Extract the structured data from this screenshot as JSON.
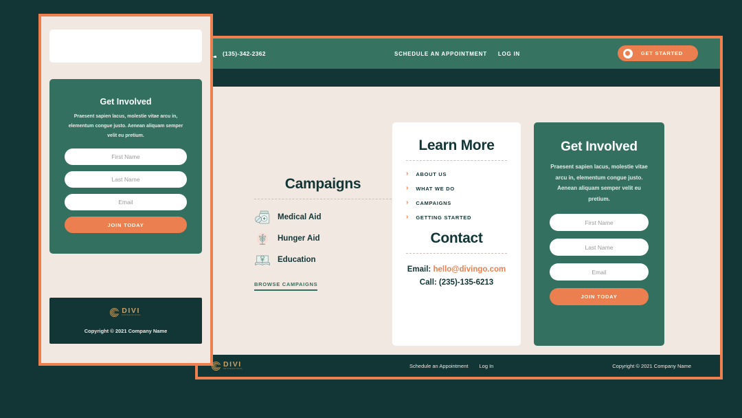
{
  "colors": {
    "page_bg": "#123536",
    "panel_border": "#ee7f4e",
    "cream": "#f1e8e2",
    "green": "#337060",
    "dark_teal": "#123536",
    "orange": "#ec7f50",
    "gold": "#c8a268"
  },
  "desktop": {
    "topbar": {
      "phone": "(135)-342-2362",
      "phone_icon": "phone-icon",
      "links": [
        {
          "label": "SCHEDULE AN APPOINTMENT"
        },
        {
          "label": "LOG IN"
        }
      ],
      "cta": {
        "label": "GET STARTED",
        "icon": "circle-dot-icon"
      }
    },
    "campaigns": {
      "title": "Campaigns",
      "items": [
        {
          "label": "Medical Aid",
          "icon": "medicine-bottle-icon"
        },
        {
          "label": "Hunger Aid",
          "icon": "plant-sprout-icon"
        },
        {
          "label": "Education",
          "icon": "open-book-icon"
        }
      ],
      "browse_label": "BROWSE CAMPAIGNS"
    },
    "learn_more": {
      "title": "Learn More",
      "items": [
        {
          "label": "ABOUT US",
          "icon": "chevron-right-icon"
        },
        {
          "label": "WHAT WE DO",
          "icon": "chevron-right-icon"
        },
        {
          "label": "CAMPAIGNS",
          "icon": "chevron-right-icon"
        },
        {
          "label": "GETTING STARTED",
          "icon": "chevron-right-icon"
        }
      ],
      "contact_title": "Contact",
      "email_label": "Email:",
      "email_value": "hello@divingo.com",
      "call_label": "Call:",
      "call_value": "(235)-135-6213"
    },
    "get_involved": {
      "title": "Get Involved",
      "body": "Praesent sapien lacus, molestie vitae arcu in, elementum congue justo. Aenean aliquam semper velit eu pretium.",
      "first_name_placeholder": "First Name",
      "last_name_placeholder": "Last Name",
      "email_placeholder": "Email",
      "first_name_value": "",
      "last_name_value": "",
      "email_value": "",
      "submit_label": "JOIN TODAY"
    },
    "footer": {
      "logo_name": "DIVI",
      "logo_sub": "PROFESSIONAL",
      "logo_icon": "divi-spiral-icon",
      "links": [
        {
          "label": "Schedule an Appointment"
        },
        {
          "label": "Log In"
        }
      ],
      "copyright": "Copyright © 2021 Company Name"
    }
  },
  "mobile": {
    "get_involved": {
      "title": "Get Involved",
      "body": "Praesent sapien lacus, molestie vitae arcu in, elementum congue justo. Aenean aliquam semper velit eu pretium.",
      "first_name_placeholder": "First Name",
      "last_name_placeholder": "Last Name",
      "email_placeholder": "Email",
      "first_name_value": "",
      "last_name_value": "",
      "email_value": "",
      "submit_label": "JOIN TODAY"
    },
    "footer": {
      "logo_name": "DIVI",
      "logo_sub": "PROFESSIONAL",
      "logo_icon": "divi-spiral-icon",
      "copyright": "Copyright © 2021 Company Name"
    }
  }
}
